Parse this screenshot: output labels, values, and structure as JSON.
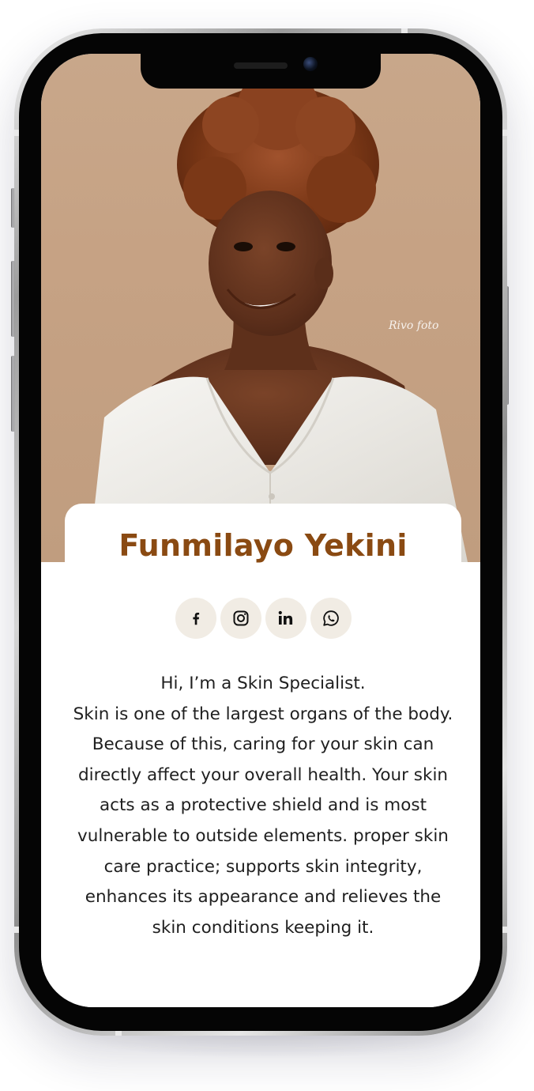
{
  "profile": {
    "name": "Funmilayo Yekini",
    "photo_alt": "Portrait photo",
    "photo_signature": "Rivo foto"
  },
  "socials": [
    {
      "icon": "facebook-icon"
    },
    {
      "icon": "instagram-icon"
    },
    {
      "icon": "linkedin-icon"
    },
    {
      "icon": "whatsapp-icon"
    }
  ],
  "bio": {
    "greeting": "Hi, I’m a Skin Specialist.",
    "text": "Skin is one of the largest organs of the body. Because of this, caring for your skin can directly affect your overall health. Your skin acts as a protective shield and is most vulnerable to outside elements. proper skin care practice; supports skin integrity, enhances its appearance and relieves the skin conditions keeping it."
  },
  "colors": {
    "name": "#8a4a12",
    "photo_bg": "#c6a284",
    "social_bg": "#f1ece4",
    "text": "#1f1f1f"
  }
}
